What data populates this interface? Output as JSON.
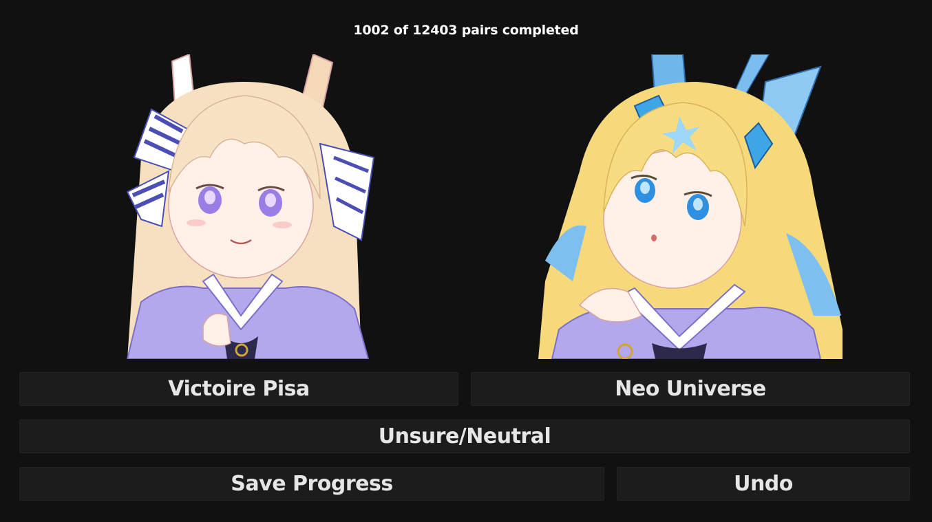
{
  "progress": {
    "text": "1002 of 12403 pairs completed"
  },
  "left_option": {
    "name": "Victoire Pisa",
    "image_icon": "character-portrait-pale-blonde-hair-purple-eyes"
  },
  "right_option": {
    "name": "Neo Universe",
    "image_icon": "character-portrait-golden-hair-blue-eyes"
  },
  "actions": {
    "neutral_label": "Unsure/Neutral",
    "save_label": "Save Progress",
    "undo_label": "Undo"
  },
  "colors": {
    "background": "#111111",
    "button_bg": "#1c1c1c",
    "button_text": "#e6e6e6"
  }
}
